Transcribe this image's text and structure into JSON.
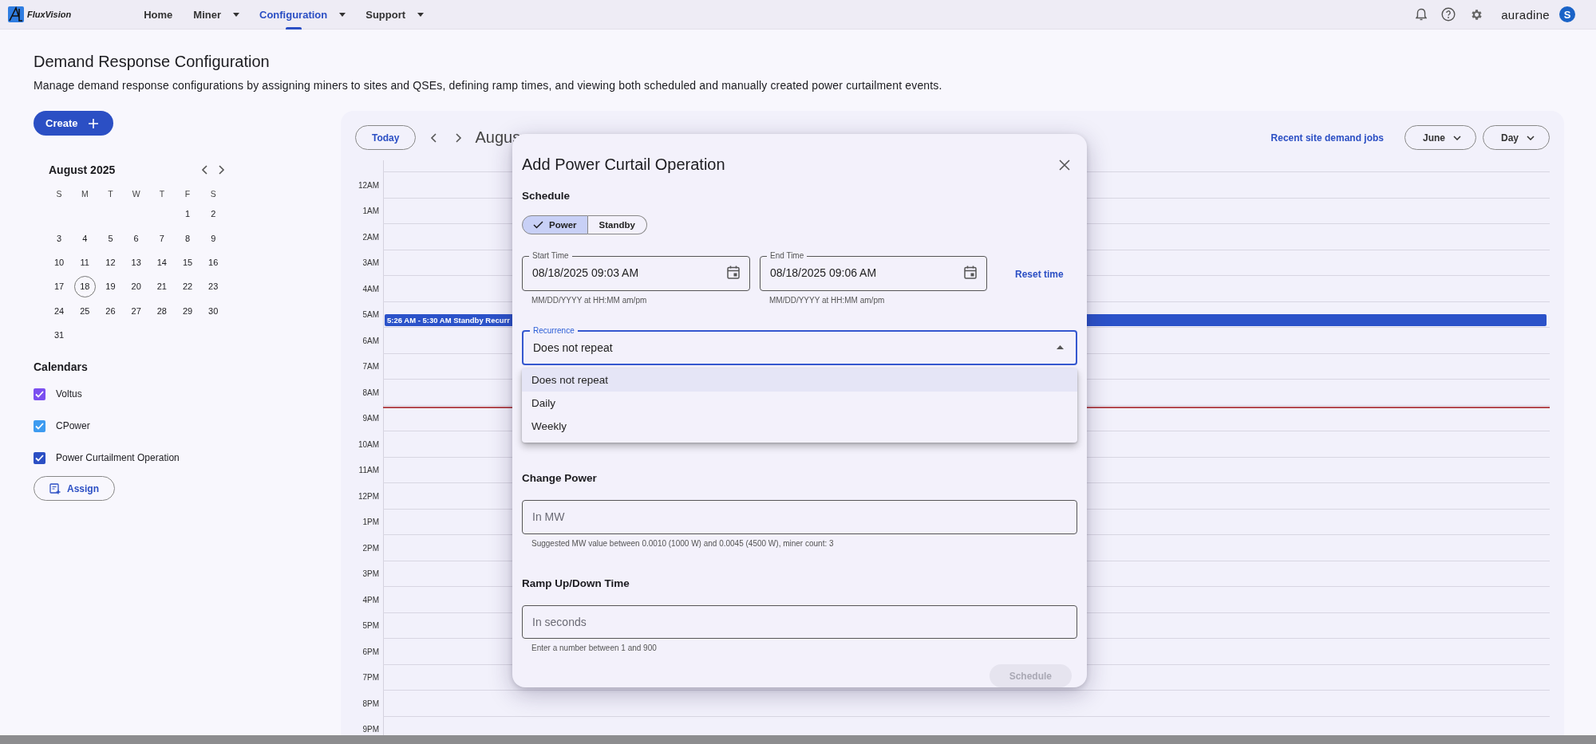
{
  "nav": {
    "logo": "FluxVision",
    "items": [
      {
        "label": "Home",
        "selected": false,
        "has_menu": false
      },
      {
        "label": "Miner",
        "selected": false,
        "has_menu": true
      },
      {
        "label": "Configuration",
        "selected": true,
        "has_menu": true
      },
      {
        "label": "Support",
        "selected": false,
        "has_menu": true
      }
    ],
    "brand": "auradine",
    "avatar": "S"
  },
  "page": {
    "title": "Demand Response Configuration",
    "description": "Manage demand response configurations by assigning miners to sites and QSEs, defining ramp times, and viewing both scheduled and manually created power curtailment events.",
    "create_button": "Create"
  },
  "mini_calendar": {
    "title": "August 2025",
    "weekdays": [
      "S",
      "M",
      "T",
      "W",
      "T",
      "F",
      "S"
    ],
    "weeks": [
      {
        "kind": "trailing",
        "days": [
          {
            "label": "1",
            "selected": false
          },
          {
            "label": "2",
            "selected": false
          }
        ]
      },
      {
        "kind": "full",
        "days": [
          {
            "label": "3",
            "selected": false
          },
          {
            "label": "4",
            "selected": false
          },
          {
            "label": "5",
            "selected": false
          },
          {
            "label": "6",
            "selected": false
          },
          {
            "label": "7",
            "selected": false
          },
          {
            "label": "8",
            "selected": false
          },
          {
            "label": "9",
            "selected": false
          }
        ]
      },
      {
        "kind": "full",
        "days": [
          {
            "label": "10",
            "selected": false
          },
          {
            "label": "11",
            "selected": false
          },
          {
            "label": "12",
            "selected": false
          },
          {
            "label": "13",
            "selected": false
          },
          {
            "label": "14",
            "selected": false
          },
          {
            "label": "15",
            "selected": false
          },
          {
            "label": "16",
            "selected": false
          }
        ]
      },
      {
        "kind": "full",
        "days": [
          {
            "label": "17",
            "selected": false
          },
          {
            "label": "18",
            "selected": true
          },
          {
            "label": "19",
            "selected": false
          },
          {
            "label": "20",
            "selected": false
          },
          {
            "label": "21",
            "selected": false
          },
          {
            "label": "22",
            "selected": false
          },
          {
            "label": "23",
            "selected": false
          }
        ]
      },
      {
        "kind": "full",
        "days": [
          {
            "label": "24",
            "selected": false
          },
          {
            "label": "25",
            "selected": false
          },
          {
            "label": "26",
            "selected": false
          },
          {
            "label": "27",
            "selected": false
          },
          {
            "label": "28",
            "selected": false
          },
          {
            "label": "29",
            "selected": false
          },
          {
            "label": "30",
            "selected": false
          }
        ]
      },
      {
        "kind": "leading",
        "days": [
          {
            "label": "31",
            "selected": false
          }
        ]
      }
    ]
  },
  "calendars": {
    "heading": "Calendars",
    "items": [
      {
        "label": "Voltus",
        "checked": true,
        "color": "#7b4ff0"
      },
      {
        "label": "CPower",
        "checked": true,
        "color": "#3d9bf0"
      },
      {
        "label": "Power Curtailment Operation",
        "checked": true,
        "color": "#2b4fc4"
      }
    ],
    "assign_button": "Assign"
  },
  "day_view": {
    "today_button": "Today",
    "date_title": "Augus",
    "jobs_link": "Recent site demand jobs",
    "month_select": "June",
    "view_select": "Day",
    "hours": [
      {
        "label": "12AM",
        "now_line": false
      },
      {
        "label": "1AM",
        "now_line": false
      },
      {
        "label": "2AM",
        "now_line": false
      },
      {
        "label": "3AM",
        "now_line": false
      },
      {
        "label": "4AM",
        "now_line": false
      },
      {
        "label": "5AM",
        "now_line": false,
        "events": [
          {
            "text": "5:26 AM - 5:30 AM Standby Recurr"
          }
        ]
      },
      {
        "label": "6AM",
        "now_line": false
      },
      {
        "label": "7AM",
        "now_line": false
      },
      {
        "label": "8AM",
        "now_line": false
      },
      {
        "label": "9AM",
        "now_line": true
      },
      {
        "label": "10AM",
        "now_line": false
      },
      {
        "label": "11AM",
        "now_line": false
      },
      {
        "label": "12PM",
        "now_line": false
      },
      {
        "label": "1PM",
        "now_line": false
      },
      {
        "label": "2PM",
        "now_line": false
      },
      {
        "label": "3PM",
        "now_line": false
      },
      {
        "label": "4PM",
        "now_line": false
      },
      {
        "label": "5PM",
        "now_line": false
      },
      {
        "label": "6PM",
        "now_line": false
      },
      {
        "label": "7PM",
        "now_line": false
      },
      {
        "label": "8PM",
        "now_line": false
      },
      {
        "label": "9PM",
        "now_line": false
      }
    ]
  },
  "dialog": {
    "title": "Add Power Curtail Operation",
    "schedule_heading": "Schedule",
    "mode_toggle": [
      {
        "label": "Power",
        "selected": true
      },
      {
        "label": "Standby",
        "selected": false
      }
    ],
    "start_time": {
      "label": "Start Time",
      "value": "08/18/2025 09:03 AM",
      "helper": "MM/DD/YYYY at HH:MM am/pm"
    },
    "end_time": {
      "label": "End Time",
      "value": "08/18/2025 09:06 AM",
      "helper": "MM/DD/YYYY at HH:MM am/pm"
    },
    "reset_link": "Reset time",
    "recurrence": {
      "label": "Recurrence",
      "value": "Does not repeat",
      "expanded": true,
      "options": [
        {
          "label": "Does not repeat",
          "selected": true
        },
        {
          "label": "Daily",
          "selected": false
        },
        {
          "label": "Weekly",
          "selected": false
        }
      ]
    },
    "change_power": {
      "heading": "Change Power",
      "placeholder": "In MW",
      "helper": "Suggested MW value between 0.0010 (1000 W) and 0.0045 (4500 W), miner count: 3"
    },
    "ramp_time": {
      "heading": "Ramp Up/Down Time",
      "placeholder": "In seconds",
      "helper": "Enter a number between 1 and 900"
    },
    "schedule_button": {
      "label": "Schedule",
      "disabled": true
    }
  }
}
